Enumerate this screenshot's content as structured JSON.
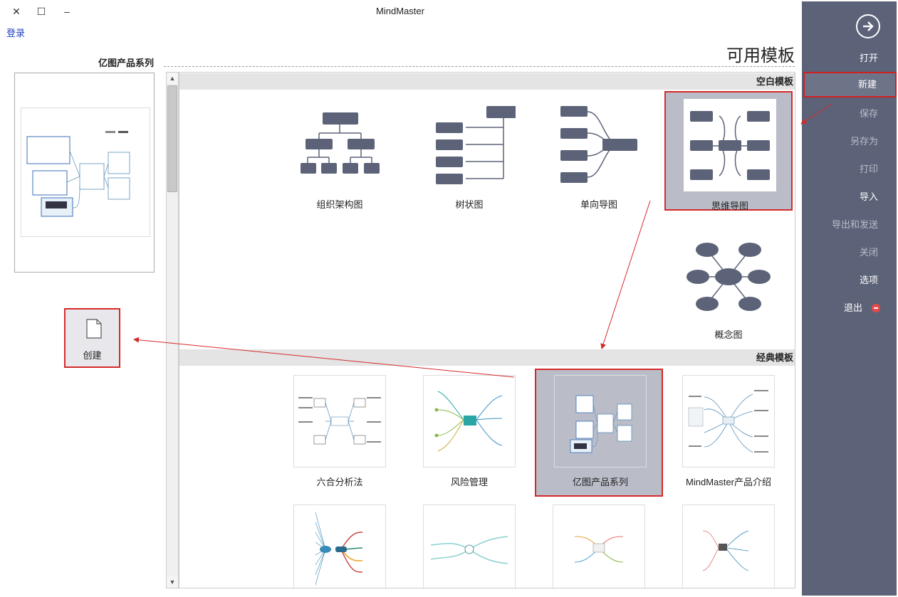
{
  "window": {
    "title": "MindMaster",
    "close_glyph": "✕",
    "maximize_glyph": "☐",
    "minimize_glyph": "‒",
    "login_label": "登录"
  },
  "sidebar": {
    "items": [
      {
        "label": "打开"
      },
      {
        "label": "新建"
      },
      {
        "label": "保存"
      },
      {
        "label": "另存为"
      },
      {
        "label": "打印"
      },
      {
        "label": "导入"
      },
      {
        "label": "导出和发送"
      },
      {
        "label": "关闭"
      },
      {
        "label": "选项"
      },
      {
        "label": "退出"
      }
    ]
  },
  "main": {
    "title": "可用模板",
    "blank_section": {
      "header": "空白模板",
      "templates": [
        {
          "label": "思维导图",
          "icon": "mindmap-icon"
        },
        {
          "label": "单向导图",
          "icon": "right-map-icon"
        },
        {
          "label": "树状图",
          "icon": "tree-map-icon"
        },
        {
          "label": "组织架构图",
          "icon": "org-chart-icon"
        },
        {
          "label": "概念图",
          "icon": "concept-map-icon"
        }
      ]
    },
    "classic_section": {
      "header": "经典模板",
      "templates": [
        {
          "label": "MindMaster产品介绍"
        },
        {
          "label": "亿图产品系列"
        },
        {
          "label": "风险管理"
        },
        {
          "label": "六合分析法"
        },
        {
          "label": ""
        },
        {
          "label": ""
        },
        {
          "label": ""
        },
        {
          "label": ""
        }
      ]
    }
  },
  "preview": {
    "title": "亿图产品系列",
    "create_label": "创建"
  },
  "colors": {
    "sidebar_bg": "#5c6378",
    "highlight_border": "#d42a2a",
    "node_fill": "#5c6378",
    "selected_tile_bg": "#babdc8"
  }
}
